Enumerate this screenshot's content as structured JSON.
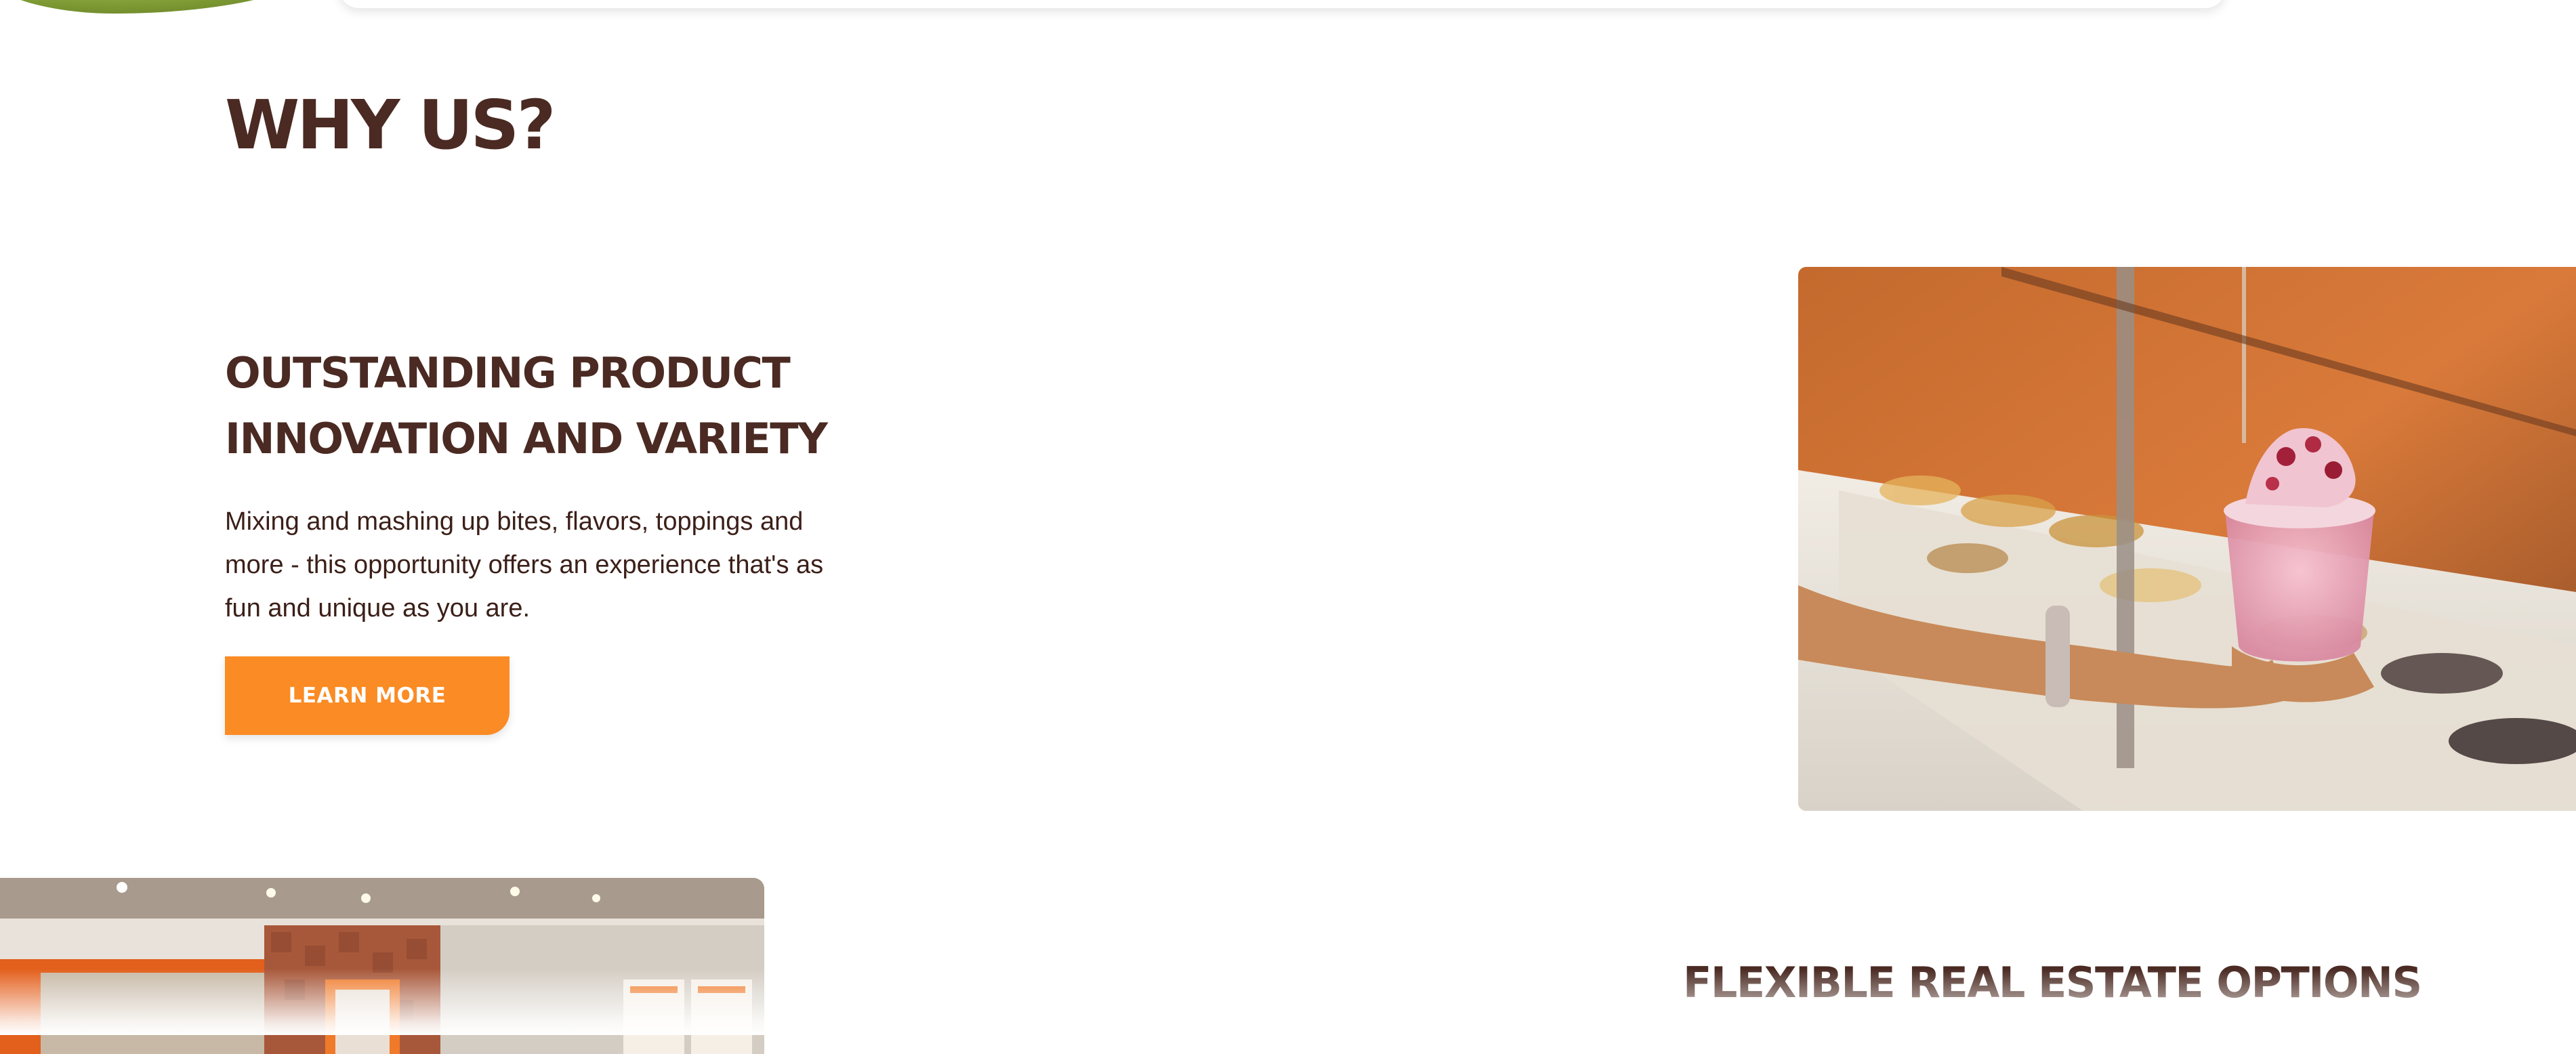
{
  "why_us": {
    "title": "WHY US?"
  },
  "features": [
    {
      "heading": "OUTSTANDING PRODUCT INNOVATION AND VARIETY",
      "body": "Mixing and mashing up bites, flavors, toppings and more - this opportunity offers an experience that's as fun and unique as you are.",
      "button_label": "LEARN MORE",
      "image_icon": "frozen-yogurt-cup-photo"
    },
    {
      "heading": "FLEXIBLE REAL ESTATE OPTIONS",
      "image_icon": "store-interior-photo"
    }
  ],
  "colors": {
    "heading": "#4a2a22",
    "body_text": "#3b1f18",
    "button_bg": "#fb8b24",
    "button_text": "#ffffff",
    "background": "#ffffff"
  }
}
